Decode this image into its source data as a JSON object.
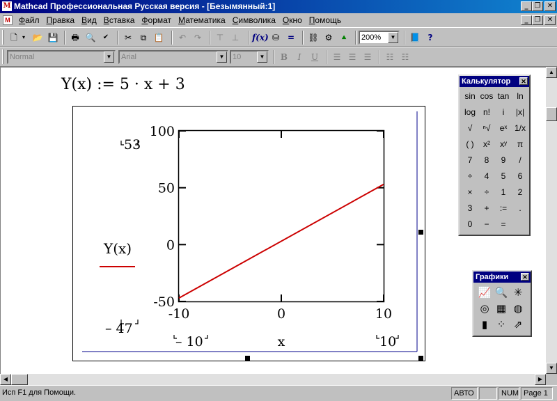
{
  "window": {
    "title": "Mathcad Профессиональная Русская версия - [Безымянный:1]",
    "app_controls": [
      "_",
      "❐",
      "✕"
    ],
    "doc_controls": [
      "_",
      "❐",
      "✕"
    ]
  },
  "menu": [
    {
      "u": "Ф",
      "rest": "айл"
    },
    {
      "u": "П",
      "rest": "равка"
    },
    {
      "u": "В",
      "rest": "ид"
    },
    {
      "u": "В",
      "rest": "ставка"
    },
    {
      "u": "Ф",
      "rest": "ормат"
    },
    {
      "u": "М",
      "rest": "атематика"
    },
    {
      "u": "С",
      "rest": "имволика"
    },
    {
      "u": "О",
      "rest": "кно"
    },
    {
      "u": "П",
      "rest": "омощь"
    }
  ],
  "toolbar": {
    "zoom": "200%",
    "style": "Normal",
    "font": "Arial",
    "size": "10",
    "bold": "B",
    "italic": "I",
    "underline": "U"
  },
  "worksheet": {
    "definition": "Y(x) := 5 · x + 3"
  },
  "plot": {
    "y_max_limit": "53",
    "y_min_limit": "– 47",
    "x_min_limit": "– 10",
    "x_max_limit": "10",
    "x_label": "x",
    "trace_label": "Y(x)",
    "line_color": "#cc0000"
  },
  "chart_data": {
    "type": "line",
    "x": [
      -10,
      10
    ],
    "series": [
      {
        "name": "Y(x)",
        "values": [
          -47,
          53
        ]
      }
    ],
    "xlim": [
      -10,
      10
    ],
    "ylim": [
      -50,
      100
    ],
    "xticks": [
      "-10",
      "0",
      "10"
    ],
    "yticks": [
      "100",
      "50",
      "0",
      "-50"
    ],
    "xlabel": "x",
    "ylabel": "Y(x)",
    "grid": false
  },
  "calculator": {
    "title": "Калькулятор",
    "keys": [
      "sin",
      "cos",
      "tan",
      "ln",
      "log",
      "n!",
      "i",
      "|x|",
      "√",
      "ⁿ√",
      "eˣ",
      "1/x",
      "( )",
      "x²",
      "xʸ",
      "π",
      "7",
      "8",
      "9",
      "/",
      "÷",
      "4",
      "5",
      "6",
      "×",
      "÷",
      "1",
      "2",
      "3",
      "+",
      ":=",
      ".",
      "0",
      "−",
      "="
    ]
  },
  "graphs": {
    "title": "Графики",
    "icons": [
      "xy-plot-icon",
      "zoom-icon",
      "trace-icon",
      "polar-plot-icon",
      "surface-plot-icon",
      "contour-plot-icon",
      "bar-3d-icon",
      "scatter-3d-icon",
      "vector-field-icon"
    ],
    "glyphs": [
      "📈",
      "🔍",
      "✳",
      "◎",
      "▦",
      "◍",
      "▮",
      "⁘",
      "⇗"
    ]
  },
  "status": {
    "help": "Исп F1 для Помощи.",
    "mode": "АВТО",
    "blank": "",
    "num": "NUM",
    "page": "Page 1"
  }
}
